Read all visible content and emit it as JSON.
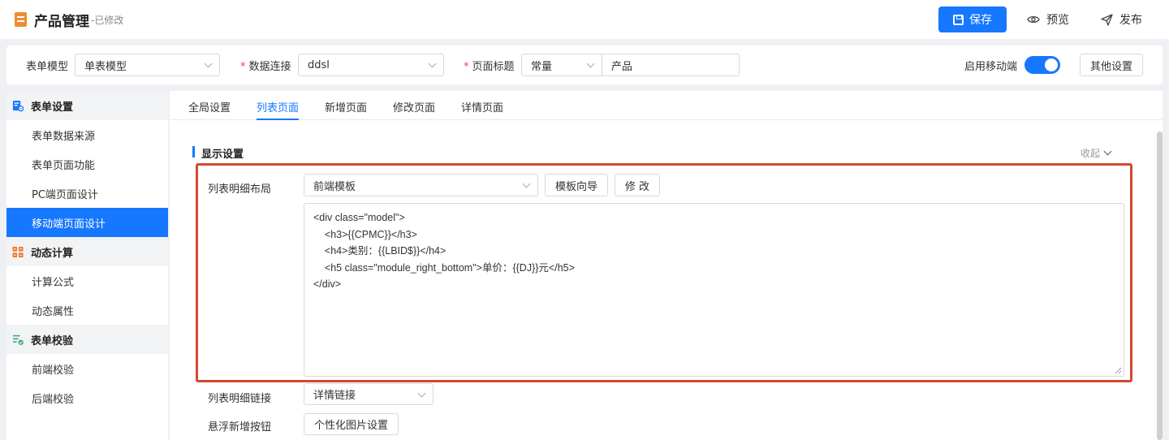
{
  "header": {
    "title": "产品管理",
    "status": "-已修改",
    "save_label": "保存",
    "preview_label": "预览",
    "publish_label": "发布"
  },
  "toolbar": {
    "form_model_label": "表单模型",
    "form_model_value": "单表模型",
    "data_conn_label": "数据连接",
    "data_conn_value": "ddsl",
    "page_title_label": "页面标题",
    "page_title_type": "常量",
    "page_title_value": "产品",
    "mobile_label": "启用移动端",
    "mobile_enabled": true,
    "other_settings_label": "其他设置"
  },
  "sidebar": {
    "groups": [
      {
        "label": "表单设置",
        "items": [
          "表单数据来源",
          "表单页面功能",
          "PC端页面设计",
          "移动端页面设计"
        ]
      },
      {
        "label": "动态计算",
        "items": [
          "计算公式",
          "动态属性"
        ]
      },
      {
        "label": "表单校验",
        "items": [
          "前端校验",
          "后端校验"
        ]
      }
    ],
    "active_item": "移动端页面设计"
  },
  "tabs": [
    "全局设置",
    "列表页面",
    "新增页面",
    "修改页面",
    "详情页面"
  ],
  "active_tab": "列表页面",
  "section": {
    "title": "显示设置",
    "collapse_label": "收起",
    "layout_label": "列表明细布局",
    "layout_value": "前端模板",
    "template_wizard_label": "模板向导",
    "modify_label": "修 改",
    "code_lines": [
      "<div class=\"model\">",
      "    <h3>{{CPMC}}</h3>",
      "    <h4>类别：{{LBID$}}</h4>",
      "    <h5 class=\"module_right_bottom\">单价：{{DJ}}元</h5>",
      "</div>"
    ],
    "link_label": "列表明细链接",
    "link_value": "详情链接",
    "float_label": "悬浮新增按钮",
    "float_btn_label": "个性化图片设置"
  },
  "colors": {
    "accent": "#1677ff",
    "highlight_border": "#d2492f",
    "required": "#e5484d"
  }
}
